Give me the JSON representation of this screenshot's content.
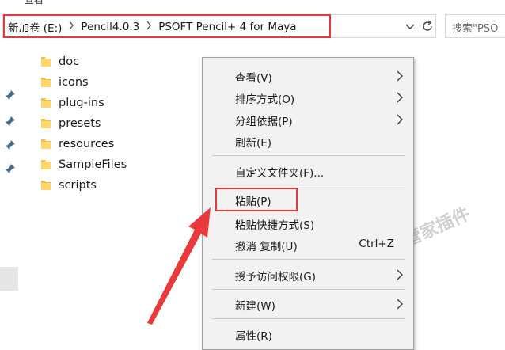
{
  "menu_bar": {
    "items": [
      "",
      "查看"
    ]
  },
  "address_bar": {
    "crumbs": [
      "新加卷 (E:)",
      "Pencil4.0.3",
      "PSOFT Pencil+ 4 for Maya"
    ],
    "annotation_color": "#e0393e"
  },
  "search": {
    "placeholder": "搜索\"PSO"
  },
  "files": [
    {
      "name": "doc",
      "icon": "folder-icon"
    },
    {
      "name": "icons",
      "icon": "folder-icon"
    },
    {
      "name": "plug-ins",
      "icon": "folder-icon"
    },
    {
      "name": "presets",
      "icon": "folder-icon"
    },
    {
      "name": "resources",
      "icon": "folder-icon"
    },
    {
      "name": "SampleFiles",
      "icon": "folder-icon"
    },
    {
      "name": "scripts",
      "icon": "folder-icon"
    }
  ],
  "context_menu": {
    "view": "查看(V)",
    "sort": "排序方式(O)",
    "group": "分组依据(P)",
    "refresh": "刷新(E)",
    "customize": "自定义文件夹(F)...",
    "paste": "粘贴(P)",
    "paste_shortcut": "粘贴快捷方式(S)",
    "undo": "撤消 复制(U)",
    "undo_shortcut": "Ctrl+Z",
    "grant_access": "授予访问权限(G)",
    "new": "新建(W)",
    "properties": "属性(R)"
  },
  "watermark": "微信公众号：管家插件"
}
